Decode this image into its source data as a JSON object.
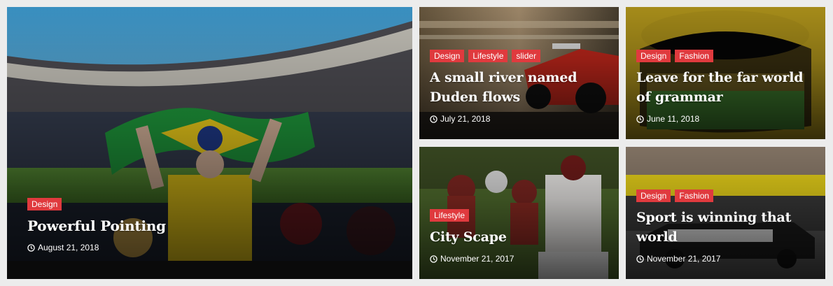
{
  "posts": [
    {
      "tags": [
        "Design"
      ],
      "title": "Powerful Pointing",
      "date": "August 21, 2018"
    },
    {
      "tags": [
        "Design",
        "Lifestyle",
        "slider"
      ],
      "title": "A small river named Duden flows",
      "date": "July 21, 2018"
    },
    {
      "tags": [
        "Design",
        "Fashion"
      ],
      "title": "Leave for the far world of grammar",
      "date": "June 11, 2018"
    },
    {
      "tags": [
        "Lifestyle"
      ],
      "title": "City Scape",
      "date": "November 21, 2017"
    },
    {
      "tags": [
        "Design",
        "Fashion"
      ],
      "title": "Sport is winning that world",
      "date": "November 21, 2017"
    }
  ],
  "colors": {
    "tag_bg": "#e03a3e",
    "text": "#ffffff",
    "page_bg": "#ececec"
  }
}
